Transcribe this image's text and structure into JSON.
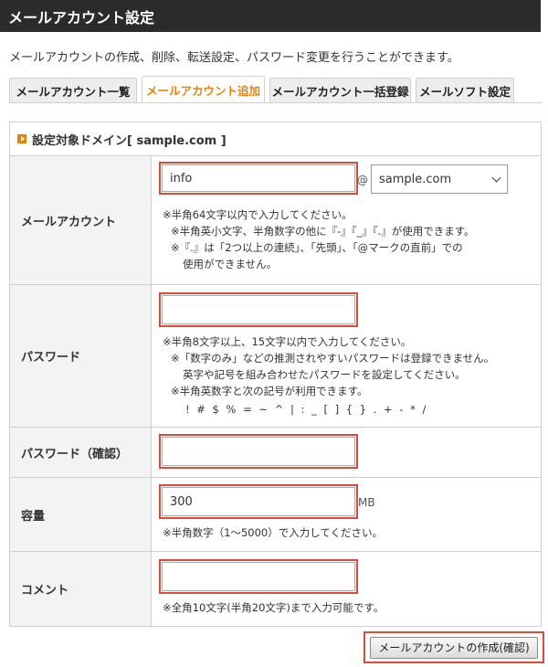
{
  "header": {
    "title": "メールアカウント設定"
  },
  "description": "メールアカウントの作成、削除、転送設定、パスワード変更を行うことができます。",
  "tabs": [
    {
      "label": "メールアカウント一覧",
      "active": false
    },
    {
      "label": "メールアカウント追加",
      "active": true
    },
    {
      "label": "メールアカウント一括登録",
      "active": false
    },
    {
      "label": "メールソフト設定",
      "active": false
    }
  ],
  "panel": {
    "title": "設定対象ドメイン[ sample.com ]"
  },
  "form": {
    "account": {
      "label": "メールアカウント",
      "value": "info",
      "at": "@",
      "domain_selected": "sample.com",
      "notes": [
        "※半角64文字以内で入力してください。",
        "※半角英小文字、半角数字の他に『-』『_』『.』が使用できます。",
        "※『.』は「2つ以上の連続」、「先頭」、「@マークの直前」での",
        "使用ができません。"
      ]
    },
    "password": {
      "label": "パスワード",
      "value": "",
      "notes": [
        "※半角8文字以上、15文字以内で入力してください。",
        "※「数字のみ」などの推測されやすいパスワードは登録できません。",
        "英字や記号を組み合わせたパスワードを設定してください。",
        "※半角英数字と次の記号が利用できます。",
        "! # $ % = ~ ^ | : _ [ ] { } . + - * /"
      ]
    },
    "password_confirm": {
      "label": "パスワード（確認）",
      "value": ""
    },
    "quota": {
      "label": "容量",
      "value": "300",
      "unit": "MB",
      "note": "※半角数字（1～5000）で入力してください。"
    },
    "comment": {
      "label": "コメント",
      "value": "",
      "note": "※全角10文字(半角20文字)まで入力可能です。"
    }
  },
  "submit_label": "メールアカウントの作成(確認)",
  "colors": {
    "accent": "#e8820c",
    "highlight": "#d94b3b",
    "header_bg": "#2b2b2b"
  }
}
